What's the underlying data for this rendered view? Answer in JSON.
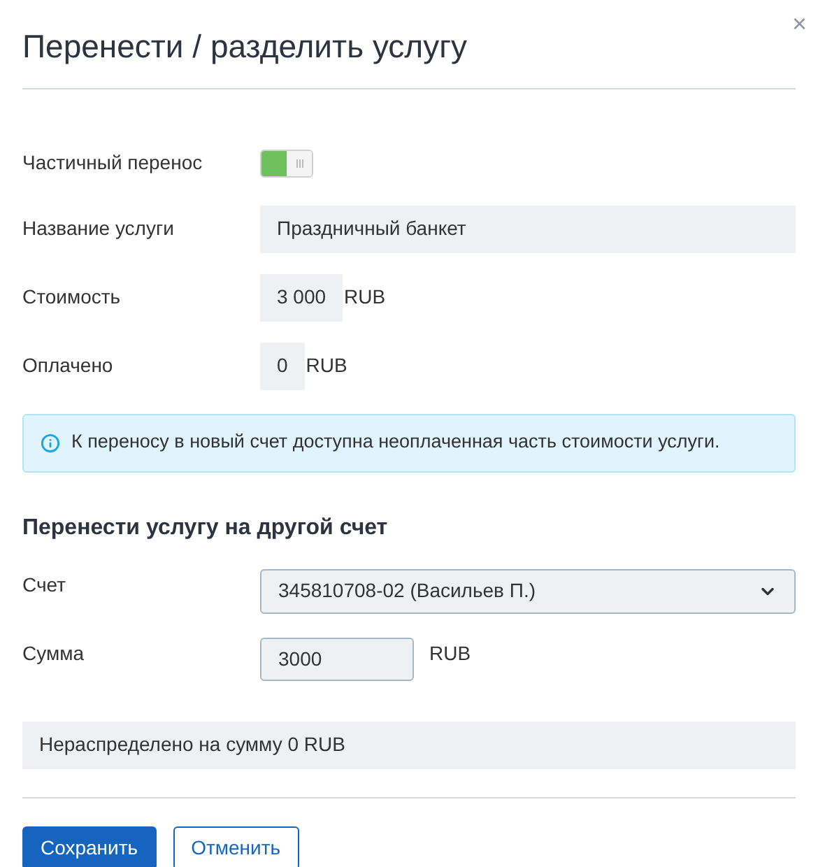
{
  "dialog": {
    "title": "Перенести / разделить услугу",
    "close": "×"
  },
  "partial": {
    "label": "Частичный перенос",
    "on": true
  },
  "fields": [
    {
      "label": "Название услуги",
      "value": "Праздничный банкет",
      "kind": "wide"
    },
    {
      "label": "Стоимость",
      "value": "3 000",
      "unit": "RUB",
      "kind": "amount"
    },
    {
      "label": "Оплачено",
      "value": "0",
      "unit": "RUB",
      "kind": "amount"
    }
  ],
  "info": "К переносу в новый счет доступна неоплаченная часть стоимости услуги.",
  "section": {
    "title": "Перенести услугу на другой счет"
  },
  "account": {
    "label": "Счет",
    "value": "345810708-02 (Васильев П.)"
  },
  "sum": {
    "label": "Сумма",
    "value": "3000",
    "unit": "RUB"
  },
  "unallocated": "Нераспределено на сумму 0 RUB",
  "buttons": [
    {
      "label": "Сохранить",
      "kind": "primary"
    },
    {
      "label": "Отменить",
      "kind": "secondary"
    }
  ]
}
